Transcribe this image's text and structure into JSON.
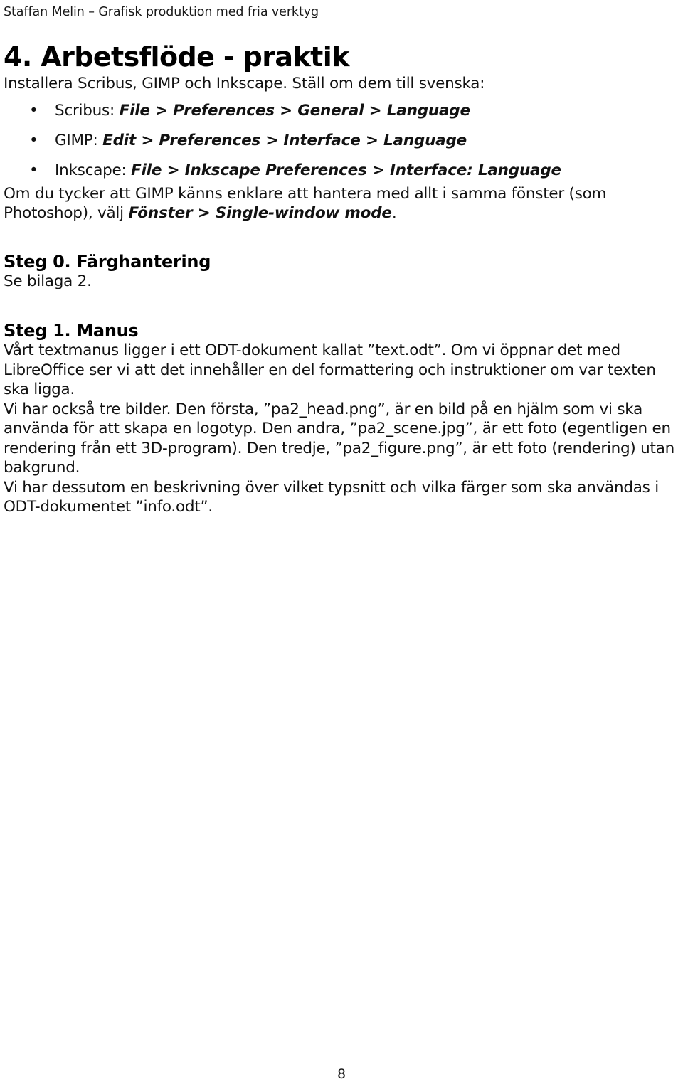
{
  "header": {
    "running_title": "Staffan Melin – Grafisk produktion med fria verktyg"
  },
  "content": {
    "title": "4. Arbetsflöde - praktik",
    "lead_paragraph": "Installera Scribus, GIMP och Inkscape. Ställ om dem till svenska:",
    "menu_list": [
      {
        "bullet": "•",
        "app": "Scribus: ",
        "path": "File > Preferences > General > Language"
      },
      {
        "bullet": "•",
        "app": "GIMP: ",
        "path": "Edit > Preferences > Interface > Language"
      },
      {
        "bullet": "•",
        "app": "Inkscape: ",
        "path": "File > Inkscape Preferences > Interface: Language"
      }
    ],
    "single_window": {
      "text_before": "Om du tycker att GIMP känns enklare att hantera med allt i samma fönster (som Photoshop), välj ",
      "path": "Fönster > Single-window mode",
      "text_after": "."
    },
    "step0": {
      "heading": "Steg 0. Färghantering",
      "body": "Se bilaga 2."
    },
    "step1": {
      "heading": "Steg 1. Manus",
      "paragraph_1": "Vårt textmanus ligger i ett ODT-dokument kallat ”text.odt”. Om vi öppnar det med LibreOffice ser vi att det innehåller en del formattering och instruktioner om var texten ska ligga.",
      "paragraph_2": "Vi har också tre bilder. Den första, ”pa2_head.png”, är en bild på en hjälm som vi ska använda för att skapa en logotyp. Den andra, ”pa2_scene.jpg”, är ett foto (egentligen en rendering från ett 3D-program). Den tredje, ”pa2_figure.png”, är ett foto (rendering) utan bakgrund.",
      "paragraph_3": "Vi har dessutom en beskrivning över vilket typsnitt och vilka färger som ska användas i ODT-dokumentet ”info.odt”."
    }
  },
  "footer": {
    "page_number": "8"
  }
}
